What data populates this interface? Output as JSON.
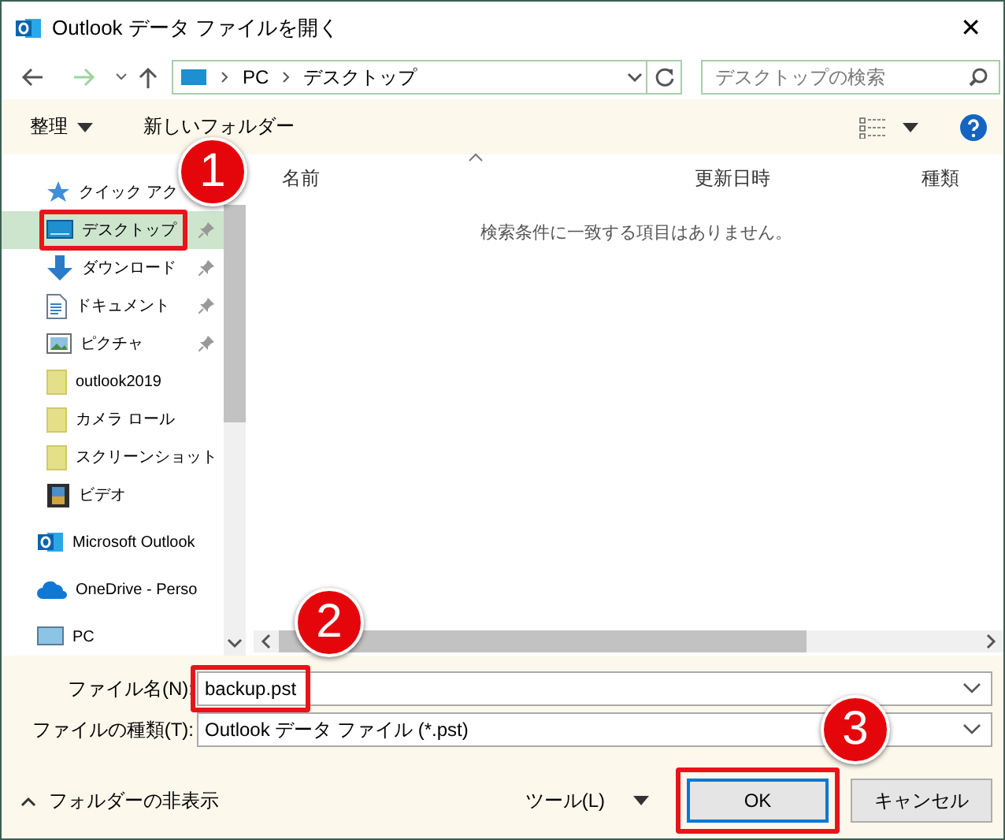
{
  "window": {
    "title": "Outlook データ ファイルを開く",
    "close": "✕"
  },
  "nav": {
    "path": [
      "PC",
      "デスクトップ"
    ],
    "search": {
      "placeholder": "デスクトップの検索"
    }
  },
  "toolbar": {
    "organize": "整理",
    "new_folder": "新しいフォルダー"
  },
  "sidebar": {
    "items": [
      {
        "label": "クイック アク",
        "kind": "star",
        "selected": false,
        "children": [
          {
            "label": "デスクトップ",
            "kind": "desktop",
            "pinned": true,
            "selected": true,
            "highlighted": true
          },
          {
            "label": "ダウンロード",
            "kind": "download",
            "pinned": true,
            "selected": false,
            "highlighted": false
          },
          {
            "label": "ドキュメント",
            "kind": "document",
            "pinned": true,
            "selected": false,
            "highlighted": false
          },
          {
            "label": "ピクチャ",
            "kind": "picture",
            "pinned": true,
            "selected": false,
            "highlighted": false
          },
          {
            "label": "outlook2019",
            "kind": "folder",
            "pinned": false,
            "selected": false,
            "highlighted": false
          },
          {
            "label": "カメラ ロール",
            "kind": "folder",
            "pinned": false,
            "selected": false,
            "highlighted": false
          },
          {
            "label": "スクリーンショット",
            "kind": "folder",
            "pinned": false,
            "selected": false,
            "highlighted": false
          },
          {
            "label": "ビデオ",
            "kind": "video",
            "pinned": false,
            "selected": false,
            "highlighted": false
          }
        ]
      },
      {
        "label": "Microsoft Outlook",
        "kind": "outlook",
        "selected": false
      },
      {
        "label": "OneDrive - Perso",
        "kind": "onedrive",
        "selected": false
      },
      {
        "label": "PC",
        "kind": "pc",
        "selected": false
      }
    ]
  },
  "file_list": {
    "columns": [
      "名前",
      "更新日時",
      "種類"
    ],
    "empty_message": "検索条件に一致する項目はありません。"
  },
  "footer": {
    "file_name": {
      "label": "ファイル名(N):",
      "value": "backup.pst",
      "highlighted": true
    },
    "file_type": {
      "label": "ファイルの種類(T):",
      "value": "Outlook データ ファイル (*.pst)"
    },
    "hide_folders": "フォルダーの非表示",
    "tools": "ツール(L)",
    "ok": {
      "label": "OK",
      "highlighted": true
    },
    "cancel": "キャンセル"
  },
  "annotations": [
    {
      "number": "1"
    },
    {
      "number": "2"
    },
    {
      "number": "3"
    }
  ]
}
